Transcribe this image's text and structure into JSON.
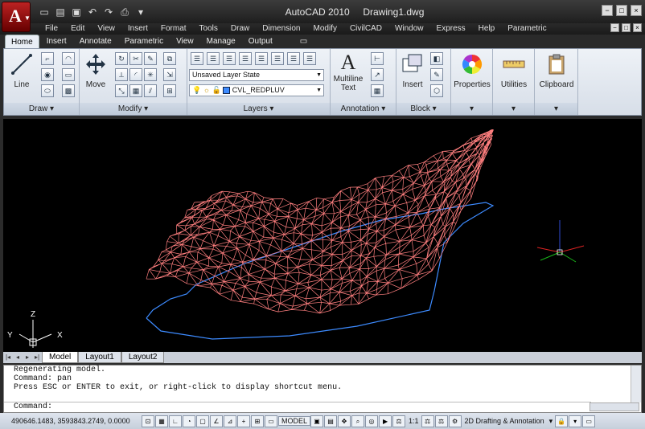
{
  "window": {
    "app_name": "AutoCAD 2010",
    "doc_name": "Drawing1.dwg",
    "controls": [
      "−",
      "□",
      "×"
    ]
  },
  "menus": [
    "File",
    "Edit",
    "View",
    "Insert",
    "Format",
    "Tools",
    "Draw",
    "Dimension",
    "Modify",
    "CivilCAD",
    "Window",
    "Express",
    "Help",
    "Parametric"
  ],
  "ribbon_tabs": [
    "Home",
    "Insert",
    "Annotate",
    "Parametric",
    "View",
    "Manage",
    "Output"
  ],
  "ribbon": {
    "draw": {
      "title": "Draw",
      "line_label": "Line"
    },
    "modify": {
      "title": "Modify",
      "move_label": "Move"
    },
    "layers": {
      "title": "Layers",
      "layer_state": "Unsaved Layer State",
      "current_layer": "CVL_REDPLUV"
    },
    "annotation": {
      "title": "Annotation",
      "multiline_label": "Multiline",
      "text_label": "Text"
    },
    "block": {
      "title": "Block",
      "insert_label": "Insert"
    },
    "properties_label": "Properties",
    "utilities_label": "Utilities",
    "clipboard_label": "Clipboard"
  },
  "layout_tabs": [
    "Model",
    "Layout1",
    "Layout2"
  ],
  "ucs": {
    "z": "Z",
    "y": "Y",
    "x": "X"
  },
  "command_history": [
    "Regenerating model.",
    "Command: pan",
    "Press ESC or ENTER to exit, or right-click to display shortcut menu."
  ],
  "command_prompt": "Command:",
  "status": {
    "coords": "490646.1483, 3593843.2749, 0.0000",
    "model_label": "MODEL",
    "scale": "1:1",
    "workspace": "2D Drafting & Annotation"
  },
  "colors": {
    "mesh": "#ff7f7f",
    "boundary": "#3d8bff",
    "viewport_bg": "#000000"
  }
}
